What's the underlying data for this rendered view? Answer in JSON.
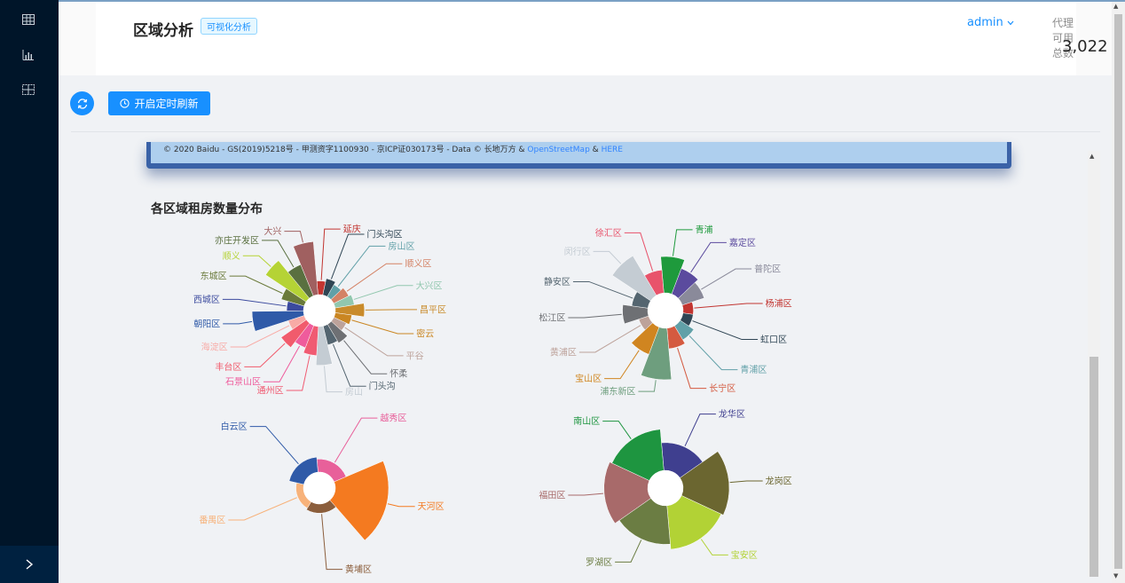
{
  "header": {
    "title": "区域分析",
    "tag": "可视化分析",
    "user": "admin",
    "stat_label": "代理可用总数",
    "stat_value": "3,022"
  },
  "toolbar": {
    "timer_label": "开启定时刷新"
  },
  "map": {
    "copyright": "© 2020 Baidu - GS(2019)5218号 - 甲测资字1100930 - 京ICP证030173号 - Data © 长地万方 &",
    "link1": "OpenStreetMap",
    "link_sep": "&",
    "link2": "HERE"
  },
  "section": {
    "title": "各区域租房数量分布"
  },
  "colors": {
    "sidebar": "#001529",
    "accent": "#1890ff",
    "background": "#f0f2f5"
  },
  "icons": [
    "table-icon",
    "bar-chart-icon",
    "grid-icon",
    "chevron-right-icon",
    "refresh-icon",
    "clock-icon",
    "chevron-down-icon"
  ],
  "chart_data": [
    {
      "type": "pie",
      "rose": true,
      "title": "",
      "categories": [
        "延庆",
        "门头沟区",
        "房山区",
        "顺义区",
        "大兴区",
        "昌平区",
        "密云",
        "平谷",
        "怀柔",
        "门头沟",
        "房山",
        "通州区",
        "石景山区",
        "丰台区",
        "海淀区",
        "朝阳区",
        "西城区",
        "东城区",
        "顺义",
        "亦庄开发区",
        "大兴"
      ],
      "values": [
        2,
        3,
        2,
        3,
        4,
        9,
        3,
        2,
        5,
        4,
        16,
        9,
        6,
        10,
        3,
        28,
        3,
        6,
        25,
        12,
        30
      ],
      "colors": [
        "#c23531",
        "#2f4554",
        "#61a0a8",
        "#d48265",
        "#91c7ae",
        "#c98b2b",
        "#ca8622",
        "#bda29a",
        "#6e7074",
        "#546570",
        "#c4ccd3",
        "#f05b72",
        "#ef5b9c",
        "#f15b6c",
        "#f8aba6",
        "#2f5aa8",
        "#3b4a9e",
        "#6a7a3a",
        "#b5d335",
        "#5a7040",
        "#a06060"
      ]
    },
    {
      "type": "pie",
      "rose": true,
      "title": "",
      "categories": [
        "青浦",
        "嘉定区",
        "普陀区",
        "杨浦区",
        "虹口区",
        "青浦区",
        "长宁区",
        "浦东新区",
        "宝山区",
        "黄浦区",
        "松江区",
        "静安区",
        "闵行区",
        "徐汇区"
      ],
      "values": [
        25,
        14,
        10,
        2,
        2,
        5,
        8,
        50,
        16,
        2,
        12,
        5,
        40,
        10
      ],
      "colors": [
        "#1e9a3c",
        "#5b4b9e",
        "#8a8a9a",
        "#c23531",
        "#2f4554",
        "#61a0a8",
        "#d45a40",
        "#6e9e7e",
        "#d08520",
        "#bda29a",
        "#6e7074",
        "#546570",
        "#c4ccd3",
        "#e8536b"
      ]
    },
    {
      "type": "pie",
      "rose": true,
      "title": "",
      "categories": [
        "越秀区",
        "天河区",
        "黄埔区",
        "番禺区",
        "白云区"
      ],
      "values": [
        6,
        100,
        3,
        2,
        8
      ],
      "colors": [
        "#e8609a",
        "#f47a20",
        "#8b5e3c",
        "#f7b27a",
        "#2f5aa8"
      ]
    },
    {
      "type": "pie",
      "rose": true,
      "title": "",
      "categories": [
        "龙华区",
        "龙岗区",
        "宝安区",
        "罗湖区",
        "福田区",
        "南山区"
      ],
      "values": [
        18,
        50,
        45,
        35,
        45,
        40
      ],
      "colors": [
        "#3f3f8f",
        "#6b6630",
        "#b2d235",
        "#6b7d43",
        "#a86a6a",
        "#1e9540"
      ]
    }
  ]
}
